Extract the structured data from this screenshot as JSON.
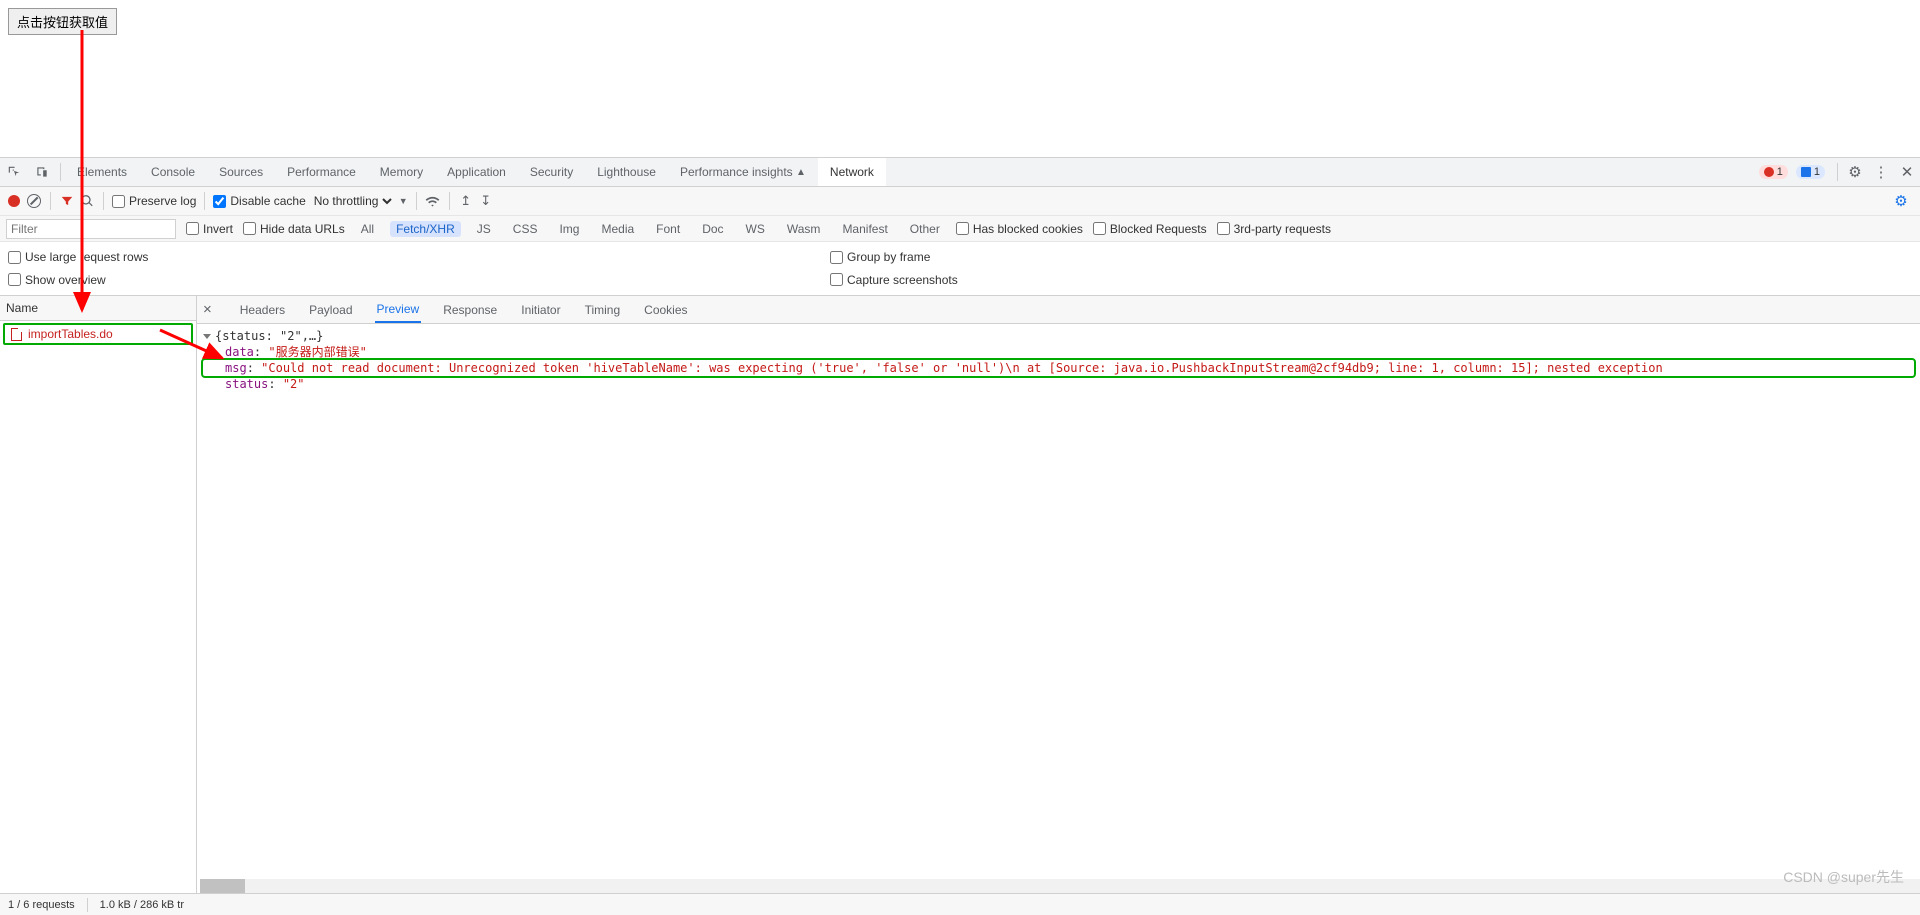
{
  "page": {
    "button_label": "点击按钮获取值"
  },
  "tabs": {
    "elements": "Elements",
    "console": "Console",
    "sources": "Sources",
    "performance": "Performance",
    "memory": "Memory",
    "application": "Application",
    "security": "Security",
    "lighthouse": "Lighthouse",
    "perf_insights": "Performance insights",
    "network": "Network"
  },
  "right_badges": {
    "errors": "1",
    "messages": "1"
  },
  "netbar": {
    "preserve": "Preserve log",
    "disable": "Disable cache",
    "throttle": "No throttling"
  },
  "filter": {
    "placeholder": "Filter",
    "invert": "Invert",
    "hide": "Hide data URLs",
    "all": "All",
    "fetch": "Fetch/XHR",
    "js": "JS",
    "css": "CSS",
    "img": "Img",
    "media": "Media",
    "font": "Font",
    "doc": "Doc",
    "ws": "WS",
    "wasm": "Wasm",
    "manifest": "Manifest",
    "other": "Other",
    "blocked_cookies": "Has blocked cookies",
    "blocked_req": "Blocked Requests",
    "third": "3rd-party requests"
  },
  "options": {
    "large": "Use large request rows",
    "overview": "Show overview",
    "group": "Group by frame",
    "capture": "Capture screenshots"
  },
  "namecol": {
    "header": "Name",
    "item": "importTables.do"
  },
  "detail_tabs": {
    "headers": "Headers",
    "payload": "Payload",
    "preview": "Preview",
    "response": "Response",
    "initiator": "Initiator",
    "timing": "Timing",
    "cookies": "Cookies"
  },
  "preview": {
    "root": "{status: \"2\",…}",
    "data_key": "data",
    "data_val": "\"服务器内部错误\"",
    "msg_key": "msg",
    "msg_val": "\"Could not read document: Unrecognized token 'hiveTableName': was expecting ('true', 'false' or 'null')\\n at [Source: java.io.PushbackInputStream@2cf94db9; line: 1, column: 15]; nested exception",
    "status_key": "status",
    "status_val": "\"2\""
  },
  "status": {
    "requests": "1 / 6 requests",
    "transfer": "1.0 kB / 286 kB tr"
  },
  "watermark": "CSDN @super先生",
  "checks": {
    "disable_cache": true
  }
}
